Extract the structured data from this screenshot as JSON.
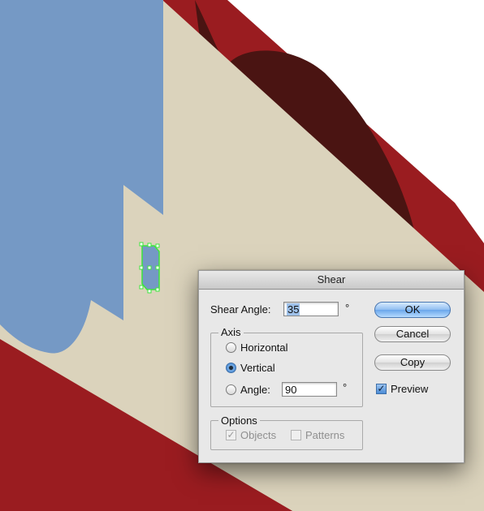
{
  "dialog": {
    "title": "Shear",
    "shear_angle_label": "Shear Angle:",
    "shear_angle_value": "35",
    "degree_symbol": "°",
    "axis": {
      "title": "Axis",
      "horizontal_label": "Horizontal",
      "vertical_label": "Vertical",
      "angle_label": "Angle:",
      "angle_value": "90",
      "selected": "vertical"
    },
    "options": {
      "title": "Options",
      "objects_label": "Objects",
      "objects_checked": true,
      "patterns_label": "Patterns",
      "patterns_checked": false
    },
    "buttons": {
      "ok": "OK",
      "cancel": "Cancel",
      "copy": "Copy"
    },
    "preview_label": "Preview",
    "preview_checked": true
  },
  "colors": {
    "sky_blue": "#7599c5",
    "beige": "#dbd3bc",
    "red": "#9a1c20",
    "dark_red": "#4a1412",
    "selection_green": "#3de63d"
  }
}
